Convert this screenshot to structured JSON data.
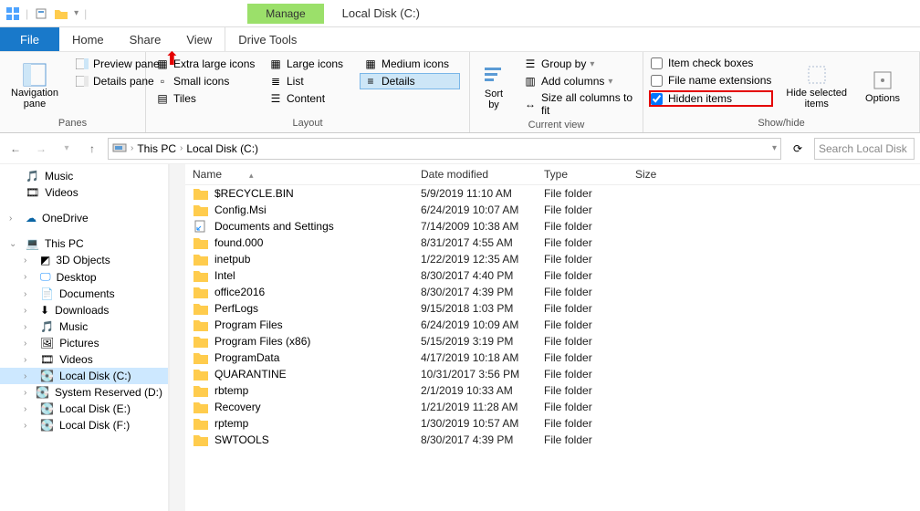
{
  "title": "Local Disk (C:)",
  "context_tab": "Manage",
  "tabs": {
    "file": "File",
    "home": "Home",
    "share": "Share",
    "view": "View",
    "drivetools": "Drive Tools"
  },
  "ribbon": {
    "panes": {
      "group": "Panes",
      "nav": "Navigation\npane",
      "preview": "Preview pane",
      "details": "Details pane"
    },
    "layout": {
      "group": "Layout",
      "xl": "Extra large icons",
      "lg": "Large icons",
      "md": "Medium icons",
      "sm": "Small icons",
      "list": "List",
      "details": "Details",
      "tiles": "Tiles",
      "content": "Content"
    },
    "current": {
      "group": "Current view",
      "sort": "Sort\nby",
      "groupby": "Group by",
      "addcols": "Add columns",
      "sizeall": "Size all columns to fit"
    },
    "showhide": {
      "group": "Show/hide",
      "itemcb": "Item check boxes",
      "fne": "File name extensions",
      "hidden": "Hidden items",
      "hidesel": "Hide selected\nitems",
      "options": "Options"
    }
  },
  "breadcrumb": {
    "thispc": "This PC",
    "c": "Local Disk (C:)"
  },
  "search_placeholder": "Search Local Disk",
  "nav": {
    "music": "Music",
    "videos": "Videos",
    "onedrive": "OneDrive",
    "thispc": "This PC",
    "d3": "3D Objects",
    "desktop": "Desktop",
    "documents": "Documents",
    "downloads": "Downloads",
    "navmusic": "Music",
    "pictures": "Pictures",
    "navvideos": "Videos",
    "localc": "Local Disk (C:)",
    "sysres": "System Reserved (D:)",
    "locale": "Local Disk (E:)",
    "localf": "Local Disk (F:)"
  },
  "columns": {
    "name": "Name",
    "date": "Date modified",
    "type": "Type",
    "size": "Size"
  },
  "rows": [
    {
      "name": "$RECYCLE.BIN",
      "date": "5/9/2019 11:10 AM",
      "type": "File folder",
      "icon": "folder"
    },
    {
      "name": "Config.Msi",
      "date": "6/24/2019 10:07 AM",
      "type": "File folder",
      "icon": "folder"
    },
    {
      "name": "Documents and Settings",
      "date": "7/14/2009 10:38 AM",
      "type": "File folder",
      "icon": "shortcut"
    },
    {
      "name": "found.000",
      "date": "8/31/2017 4:55 AM",
      "type": "File folder",
      "icon": "folder"
    },
    {
      "name": "inetpub",
      "date": "1/22/2019 12:35 AM",
      "type": "File folder",
      "icon": "folder"
    },
    {
      "name": "Intel",
      "date": "8/30/2017 4:40 PM",
      "type": "File folder",
      "icon": "folder"
    },
    {
      "name": "office2016",
      "date": "8/30/2017 4:39 PM",
      "type": "File folder",
      "icon": "folder"
    },
    {
      "name": "PerfLogs",
      "date": "9/15/2018 1:03 PM",
      "type": "File folder",
      "icon": "folder"
    },
    {
      "name": "Program Files",
      "date": "6/24/2019 10:09 AM",
      "type": "File folder",
      "icon": "folder"
    },
    {
      "name": "Program Files (x86)",
      "date": "5/15/2019 3:19 PM",
      "type": "File folder",
      "icon": "folder"
    },
    {
      "name": "ProgramData",
      "date": "4/17/2019 10:18 AM",
      "type": "File folder",
      "icon": "folder"
    },
    {
      "name": "QUARANTINE",
      "date": "10/31/2017 3:56 PM",
      "type": "File folder",
      "icon": "folder"
    },
    {
      "name": "rbtemp",
      "date": "2/1/2019 10:33 AM",
      "type": "File folder",
      "icon": "folder"
    },
    {
      "name": "Recovery",
      "date": "1/21/2019 11:28 AM",
      "type": "File folder",
      "icon": "folder"
    },
    {
      "name": "rptemp",
      "date": "1/30/2019 10:57 AM",
      "type": "File folder",
      "icon": "folder"
    },
    {
      "name": "SWTOOLS",
      "date": "8/30/2017 4:39 PM",
      "type": "File folder",
      "icon": "folder"
    }
  ]
}
